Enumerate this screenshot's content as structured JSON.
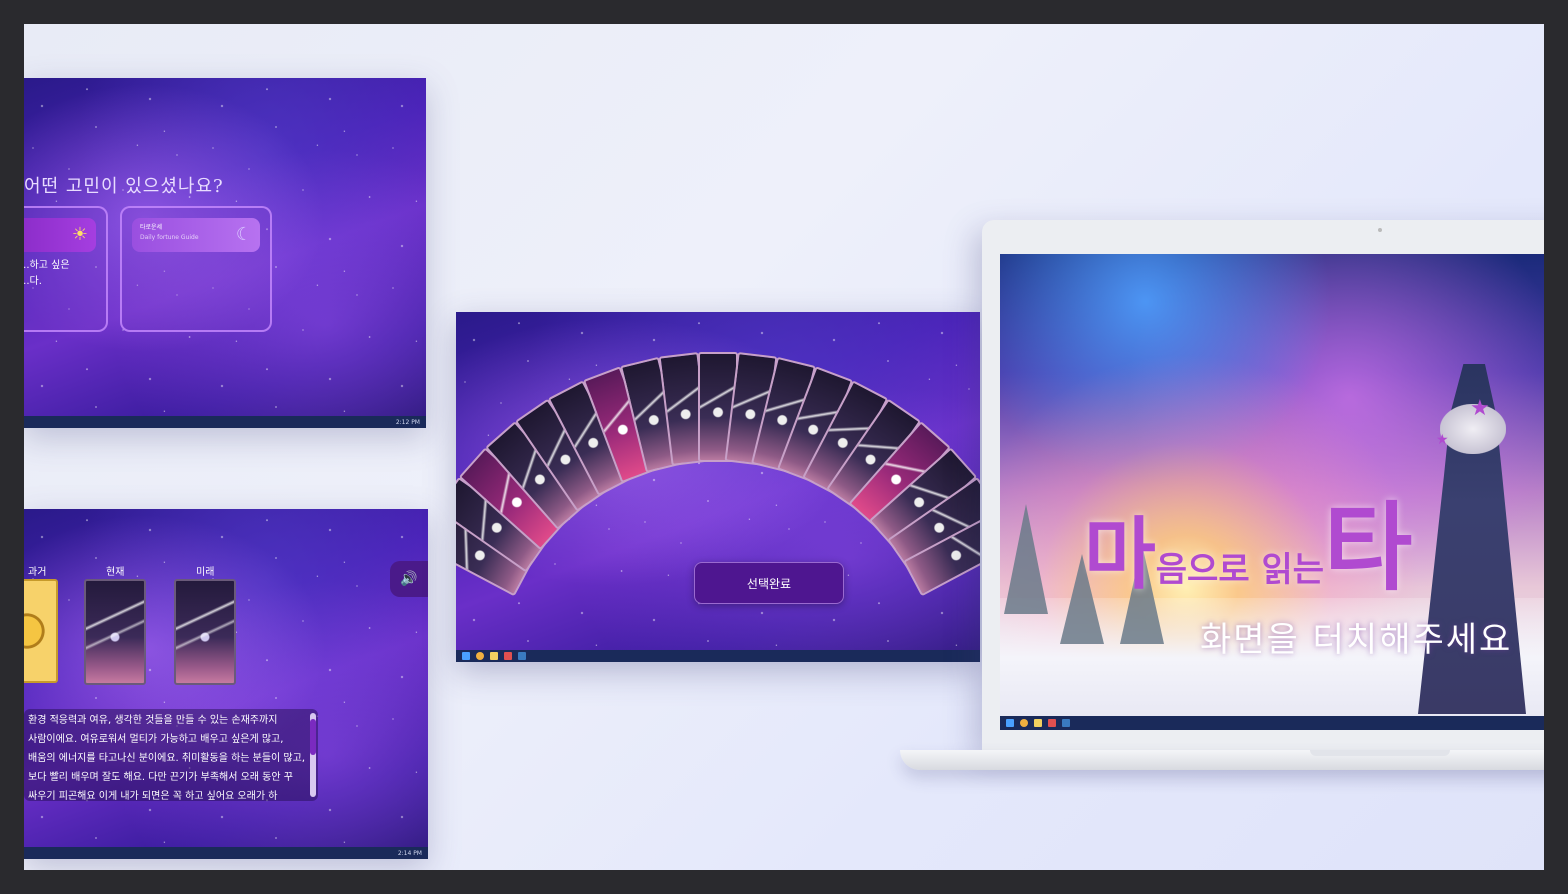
{
  "screen1": {
    "question": "어떤 고민이 있으셨나요?",
    "option_left": {
      "desc_line1": "...하고 싶은",
      "desc_line2": "...다."
    },
    "option_right": {
      "title": "타로운세",
      "subtitle": "Daily fortune Guide"
    },
    "taskbar_time": "2:12 PM"
  },
  "screen2": {
    "slots": [
      "과거",
      "현재",
      "미래"
    ],
    "story_lines": [
      "환경 적응력과 여유, 생각한 것들을 만들 수 있는 손재주까지",
      "사람이에요. 여유로워서 멀티가 가능하고 배우고 싶은게 많고,",
      "배움의 에너지를 타고나신 분이에요. 취미활동을 하는 분들이 많고,",
      "보다 빨리 배우며 잘도 해요. 다만 끈기가 부족해서 오래 동안 꾸",
      "싸우기 피곤해요 이게 내가 되면은 꼭 하고 싶어요 오래가 하"
    ],
    "taskbar_time": "2:14 PM"
  },
  "screen3": {
    "confirm_label": "선택완료"
  },
  "laptop": {
    "title_prefix": "마",
    "title_middle": "음으로 읽는",
    "title_suffix": "타",
    "touch_prompt": "화면을 터치해주세요"
  },
  "colors": {
    "accent": "#b04ad0",
    "button": "#4e1690",
    "taskbar": "#1a2a5a"
  }
}
